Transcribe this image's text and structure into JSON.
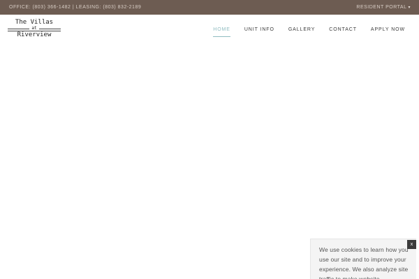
{
  "topbar": {
    "contact_text": "OFFICE: (803) 366-1482 | LEASING: (803) 832-2189",
    "portal_label": "RESIDENT PORTAL",
    "portal_icon": "chevron-down-icon",
    "background_color": "#6d5c52"
  },
  "logo": {
    "line1": "The Villas",
    "line2": "at",
    "line3": "Riverview"
  },
  "nav": {
    "items": [
      {
        "label": "HOME",
        "active": true
      },
      {
        "label": "UNIT INFO",
        "active": false
      },
      {
        "label": "GALLERY",
        "active": false
      },
      {
        "label": "CONTACT",
        "active": false
      },
      {
        "label": "APPLY NOW",
        "active": false
      }
    ],
    "active_color": "#8fbcc0"
  },
  "cookie": {
    "text": "We use cookies to learn how you use our site and to improve your experience. We also analyze site traffic to make website",
    "close_label": "x",
    "close_icon": "close-icon"
  }
}
